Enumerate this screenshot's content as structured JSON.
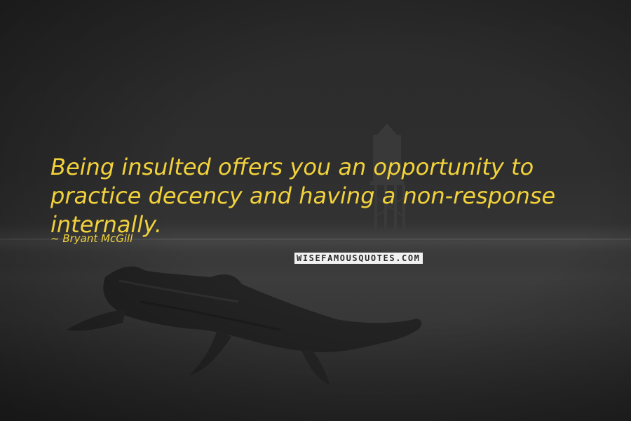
{
  "quote": {
    "text": "Being insulted offers you an opportunity to practice decency and having a non-response internally.",
    "author": "Bryant McGill"
  },
  "watermark": {
    "text": "WISEFAMOUSQUOTES.COM"
  },
  "colors": {
    "quote_text": "#f2d23b",
    "background": "#2e2e2e"
  },
  "background_image": {
    "icons": [
      "lighthouse-icon",
      "driftwood-icon"
    ]
  }
}
